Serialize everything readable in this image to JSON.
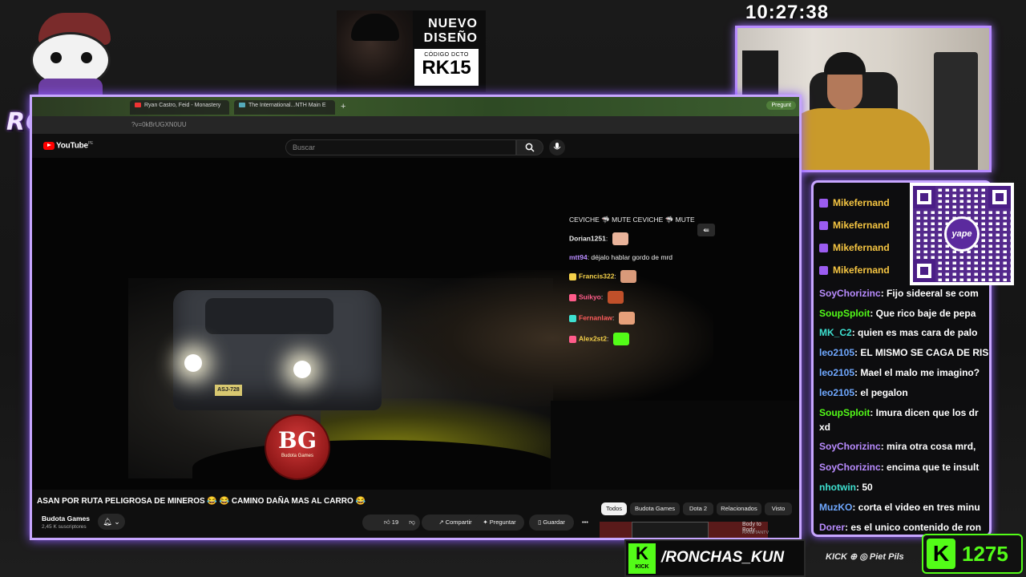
{
  "overlay": {
    "logo_text": "RONCHAS",
    "clock": "10:27:38",
    "ad": {
      "title_line1": "NUEVO",
      "title_line2": "DISEÑO",
      "code_label": "CÓDIGO DCTO",
      "code": "RK15"
    },
    "kick_handle": "/RONCHAS_KUN",
    "kick_badge": "KICK",
    "socials": "KICK ⊕ ◎ Piet Pils",
    "follower_count": "1275"
  },
  "browser": {
    "tabs": [
      {
        "label": "Ryan Castro, Feid - Monastery"
      },
      {
        "label": "The International...NTH Main E"
      }
    ],
    "ask_button": "Pregunt",
    "url": "?v=0kBrUGXN0UU"
  },
  "youtube": {
    "logo": "YouTube",
    "logo_region": "PE",
    "search_placeholder": "Buscar",
    "video_title": "ASAN POR RUTA PELIGROSA DE MINEROS 😂 😂 CAMINO DAÑA MAS AL CARRO 😂",
    "channel_name": "Budota Games",
    "subscribers": "2,45 K suscriptores",
    "likes": "19",
    "share": "Compartir",
    "ask": "Preguntar",
    "save": "Guardar",
    "more": "•••",
    "chips": [
      "Todos",
      "Budota Games",
      "Dota 2",
      "Relacionados",
      "Visto"
    ],
    "related_title": "Body to Body",
    "related_channel": "RANDTANTV",
    "plate": "ASJ-728",
    "watermark_main": "BG",
    "watermark_sub": "Budota Games"
  },
  "video_chat": [
    {
      "user": "",
      "text": "CEVICHE 🦈 MUTE CEVICHE 🦈 MUTE",
      "color": "#ffffff"
    },
    {
      "user": "Dorian1251",
      "text": "",
      "color": "#ffffff"
    },
    {
      "user": "mtt94",
      "text": "déjalo hablar gordo de mrd",
      "color": "#b98cff"
    },
    {
      "user": "Francis322",
      "text": "",
      "color": "#f5d14a"
    },
    {
      "user": "Suikyo",
      "text": "",
      "color": "#ff5c8a"
    },
    {
      "user": "Fernanlaw",
      "text": "",
      "color": "#ff5c5c"
    },
    {
      "user": "Alex2st2",
      "text": "",
      "color": "#f5d14a"
    }
  ],
  "chat": [
    {
      "user": "Mikefernand",
      "text": "",
      "color": "#f5c542"
    },
    {
      "user": "Mikefernand",
      "text": "",
      "color": "#f5c542"
    },
    {
      "user": "Mikefernand",
      "text": "",
      "color": "#f5c542"
    },
    {
      "user": "Mikefernand",
      "text": "",
      "color": "#f5c542"
    },
    {
      "user": "SoyChorizinc",
      "text": ": Fijo sideeral se com",
      "color": "#b98cff"
    },
    {
      "user": "SoupSploit",
      "text": ": Que rico baje de pepa",
      "color": "#53fc18"
    },
    {
      "user": "MK_C2",
      "text": ": quien es mas cara de palo",
      "color": "#3ee0d0"
    },
    {
      "user": "leo2105",
      "text": ": EL MISMO SE CAGA DE RIS",
      "color": "#6fa8ff"
    },
    {
      "user": "leo2105",
      "text": ": Mael el malo me imagino?",
      "color": "#6fa8ff"
    },
    {
      "user": "leo2105",
      "text": ": el pegalon",
      "color": "#6fa8ff"
    },
    {
      "user": "SoupSploit",
      "text": ": Imura dicen que los dr",
      "color": "#53fc18"
    },
    {
      "user": "",
      "text": "xd",
      "color": "#ffffff"
    },
    {
      "user": "SoyChorizinc",
      "text": ": mira otra cosa mrd,",
      "color": "#b98cff"
    },
    {
      "user": "SoyChorizinc",
      "text": ": encima que te insult",
      "color": "#b98cff"
    },
    {
      "user": "nhotwin",
      "text": ": 50",
      "color": "#3ee0d0"
    },
    {
      "user": "MuzKO",
      "text": ": corta el video en tres minu",
      "color": "#6fa8ff"
    },
    {
      "user": "Dorer",
      "text": ": es el unico contenido de ron",
      "color": "#b98cff"
    }
  ],
  "qr": {
    "brand": "yape"
  }
}
